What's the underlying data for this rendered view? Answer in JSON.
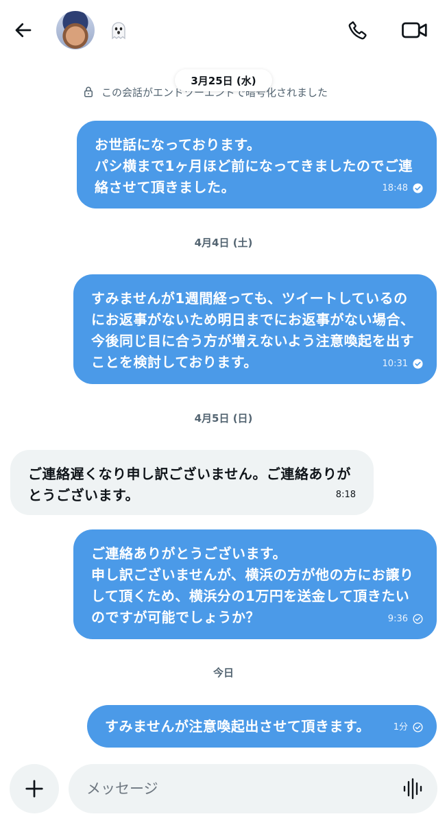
{
  "header": {
    "back_icon": "arrow-left-icon",
    "avatar_icon": "avatar",
    "status_icon": "ghost-emoji-icon",
    "status_emoji": "👻",
    "call_icon": "phone-icon",
    "video_icon": "video-camera-icon"
  },
  "conversation": {
    "top_date": "3月25日 (水)",
    "encryption_notice": "この会話がエンドツーエンドで暗号化されました",
    "encryption_icon": "lock-icon",
    "messages": [
      {
        "direction": "out",
        "text": "お世話になっております。\nパシ横まで1ヶ月ほど前になってきましたのでご連絡させて頂きました。",
        "time": "18:48",
        "status_icon": "check-circle-filled-icon"
      },
      {
        "date": "4月4日 (土)"
      },
      {
        "direction": "out",
        "text": "すみませんが1週間経っても、ツイートしているのにお返事がないため明日までにお返事がない場合、今後同じ目に合う方が増えないよう注意喚起を出すことを検討しております。",
        "time": "10:31",
        "status_icon": "check-circle-filled-icon"
      },
      {
        "date": "4月5日 (日)"
      },
      {
        "direction": "in",
        "text": "ご連絡遅くなり申し訳ございません。ご連絡ありがとうございます。",
        "time": "8:18"
      },
      {
        "direction": "out",
        "text": "ご連絡ありがとうございます。\n申し訳ございませんが、横浜の方が他の方にお譲りして頂くため、横浜分の1万円を送金して頂きたいのですが可能でしょうか？",
        "time": "9:36",
        "status_icon": "check-circle-outline-icon"
      },
      {
        "date": "今日"
      },
      {
        "direction": "out",
        "text": "すみませんが注意喚起出させて頂きます。",
        "time": "1分",
        "status_icon": "check-circle-outline-icon"
      }
    ]
  },
  "composer": {
    "plus_icon": "plus-icon",
    "placeholder": "メッセージ",
    "voice_icon": "voice-waveform-icon"
  },
  "colors": {
    "outgoing_bubble": "#4b9ae8",
    "incoming_bubble": "#eff3f4",
    "secondary_text": "#536471"
  }
}
